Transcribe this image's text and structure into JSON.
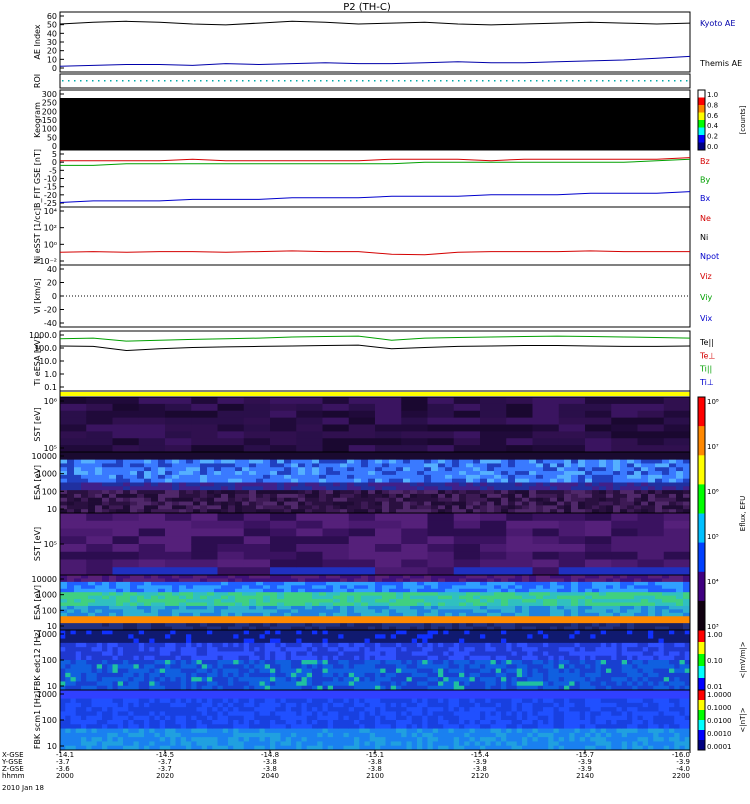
{
  "title": "P2 (TH-C)",
  "panels": [
    {
      "id": "ae",
      "ylabel": "AE Index",
      "ticks": [
        "60",
        "50",
        "40",
        "30",
        "20",
        "10",
        "0"
      ],
      "right_labels": [
        {
          "text": "Kyoto AE",
          "color": "#0000aa"
        },
        {
          "text": "Themis AE",
          "color": "#000000"
        }
      ]
    },
    {
      "id": "roi",
      "ylabel": "ROI",
      "ticks": [],
      "right_labels": []
    },
    {
      "id": "keogram",
      "ylabel": "Keogram",
      "ticks": [
        "300",
        "250",
        "200",
        "150",
        "100",
        "50",
        "0"
      ],
      "right_labels": []
    },
    {
      "id": "bfield",
      "ylabel": "B_FIT GSE [nT]",
      "ticks": [
        "5",
        "0",
        "-5",
        "-10",
        "-15",
        "-20",
        "-25"
      ],
      "right_labels": [
        {
          "text": "Bz",
          "color": "#d40000"
        },
        {
          "text": "By",
          "color": "#00a000"
        },
        {
          "text": "Bx",
          "color": "#0000cc"
        }
      ]
    },
    {
      "id": "density",
      "ylabel": "Ni eSST [1/cc]",
      "ticks": [
        "10⁴",
        "10²",
        "10⁰",
        "10⁻²"
      ],
      "right_labels": [
        {
          "text": "Ne",
          "color": "#d40000"
        },
        {
          "text": "Ni",
          "color": "#000000"
        },
        {
          "text": "Npot",
          "color": "#0000cc"
        }
      ]
    },
    {
      "id": "velocity",
      "ylabel": "Vi [km/s]",
      "ticks": [
        "40",
        "20",
        "0",
        "-20",
        "-40"
      ],
      "right_labels": [
        {
          "text": "Viz",
          "color": "#d40000"
        },
        {
          "text": "Viy",
          "color": "#00a000"
        },
        {
          "text": "Vix",
          "color": "#0000cc"
        }
      ]
    },
    {
      "id": "temperature",
      "ylabel": "Ti eESA [eV]",
      "ticks": [
        "1000.0",
        "100.0",
        "10.0",
        "1.0",
        "0.1"
      ],
      "right_labels": [
        {
          "text": "Te||",
          "color": "#000000"
        },
        {
          "text": "Te⊥",
          "color": "#d40000"
        },
        {
          "text": "Ti||",
          "color": "#00a000"
        },
        {
          "text": "Ti⊥",
          "color": "#0000cc"
        }
      ]
    },
    {
      "id": "flag",
      "ylabel": "",
      "ticks": [],
      "right_labels": []
    },
    {
      "id": "sst_e",
      "ylabel": "SST [eV]",
      "ticks": [
        "10⁶",
        "10⁵"
      ],
      "right_labels": []
    },
    {
      "id": "esa_e",
      "ylabel": "ESA [eV]",
      "ticks": [
        "10000",
        "1000",
        "100",
        "10"
      ],
      "right_labels": []
    },
    {
      "id": "sst_i",
      "ylabel": "SST [eV]",
      "ticks": [
        "10⁵"
      ],
      "right_labels": []
    },
    {
      "id": "esa_i",
      "ylabel": "ESA [eV]",
      "ticks": [
        "10000",
        "1000",
        "100",
        "10"
      ],
      "right_labels": []
    },
    {
      "id": "fbk_e",
      "ylabel": "FBK edc12 [Hz]",
      "ticks": [
        "1000",
        "100",
        "10"
      ],
      "right_labels": []
    },
    {
      "id": "fbk_b",
      "ylabel": "FBK scm1 [Hz]",
      "ticks": [
        "1000",
        "100",
        "10"
      ],
      "right_labels": []
    }
  ],
  "colorbars": [
    {
      "id": "cb_keogram",
      "label": "[counts]",
      "ticks": [
        "1.0",
        "0.8",
        "0.6",
        "0.4",
        "0.2",
        "0.0"
      ]
    },
    {
      "id": "cb_spec",
      "label": "Eflux, EFU",
      "ticks": [
        "10⁸",
        "10⁷",
        "10⁶",
        "10⁵",
        "10⁴",
        "10³"
      ]
    },
    {
      "id": "cb_fbk_e",
      "label": "<|mV/m|>",
      "ticks": [
        "1.00",
        "0.10",
        "0.01"
      ]
    },
    {
      "id": "cb_fbk_b",
      "label": "<|nT|>",
      "ticks": [
        "1.0000",
        "0.1000",
        "0.0100",
        "0.0010",
        "0.0001"
      ]
    }
  ],
  "x_axis": {
    "row_labels": [
      "X-GSE",
      "Y-GSE",
      "Z-GSE",
      "hhmm",
      "2010 Jan 18"
    ],
    "columns": [
      {
        "x": "-14.1",
        "y": "-3.7",
        "z": "-3.6",
        "t": "2000"
      },
      {
        "x": "-14.5",
        "y": "-3.7",
        "z": "-3.7",
        "t": "2020"
      },
      {
        "x": "-14.8",
        "y": "-3.8",
        "z": "-3.8",
        "t": "2040"
      },
      {
        "x": "-15.1",
        "y": "-3.8",
        "z": "-3.8",
        "t": "2100"
      },
      {
        "x": "-15.4",
        "y": "-3.9",
        "z": "-3.8",
        "t": "2120"
      },
      {
        "x": "-15.7",
        "y": "-3.9",
        "z": "-3.9",
        "t": "2140"
      },
      {
        "x": "-16.0",
        "y": "-3.9",
        "z": "-4.0",
        "t": "2200"
      }
    ]
  },
  "chart_data": {
    "type": "line",
    "time_range": [
      "2000",
      "2200"
    ],
    "series": [
      {
        "panel": "ae",
        "name": "Themis AE",
        "color": "#000000",
        "values": [
          50,
          52,
          53,
          52,
          50,
          49,
          51,
          53,
          52,
          50,
          51,
          52,
          50,
          49,
          50,
          51,
          52,
          51,
          50,
          51
        ]
      },
      {
        "panel": "ae",
        "name": "Kyoto AE",
        "color": "#0000aa",
        "values": [
          3,
          4,
          5,
          5,
          4,
          6,
          5,
          6,
          7,
          6,
          6,
          7,
          8,
          7,
          7,
          8,
          9,
          10,
          12,
          14
        ]
      },
      {
        "panel": "bfield",
        "name": "Bz",
        "color": "#d40000",
        "values": [
          1,
          1,
          1,
          1,
          2,
          1,
          1,
          1,
          1,
          1,
          2,
          2,
          2,
          1,
          2,
          2,
          2,
          2,
          2,
          3
        ]
      },
      {
        "panel": "bfield",
        "name": "By",
        "color": "#00a000",
        "values": [
          -2,
          -2,
          -1,
          -1,
          -1,
          -1,
          -1,
          -1,
          -1,
          -1,
          -1,
          0,
          0,
          0,
          0,
          0,
          0,
          0,
          1,
          2
        ]
      },
      {
        "panel": "bfield",
        "name": "Bx",
        "color": "#0000cc",
        "values": [
          -26,
          -25,
          -25,
          -25,
          -24,
          -24,
          -24,
          -23,
          -23,
          -23,
          -22,
          -22,
          -22,
          -21,
          -21,
          -21,
          -20,
          -20,
          -20,
          -19
        ]
      },
      {
        "panel": "density",
        "name": "Ne",
        "color": "#d40000",
        "values": [
          -1.5,
          -1.4,
          -1.5,
          -1.4,
          -1.4,
          -1.5,
          -1.4,
          -1.3,
          -1.4,
          -1.4,
          -1.8,
          -1.9,
          -1.5,
          -1.4,
          -1.4,
          -1.4,
          -1.3,
          -1.4,
          -1.4,
          -1.4
        ]
      },
      {
        "panel": "temperature",
        "name": "Ti||",
        "color": "#00a000",
        "values": [
          450,
          500,
          300,
          350,
          400,
          450,
          500,
          600,
          650,
          700,
          350,
          500,
          550,
          600,
          650,
          700,
          650,
          600,
          550,
          500
        ]
      },
      {
        "panel": "temperature",
        "name": "Te||",
        "color": "#000000",
        "values": [
          130,
          120,
          60,
          80,
          100,
          110,
          120,
          130,
          140,
          150,
          80,
          100,
          120,
          130,
          140,
          140,
          130,
          120,
          120,
          130
        ]
      }
    ]
  }
}
